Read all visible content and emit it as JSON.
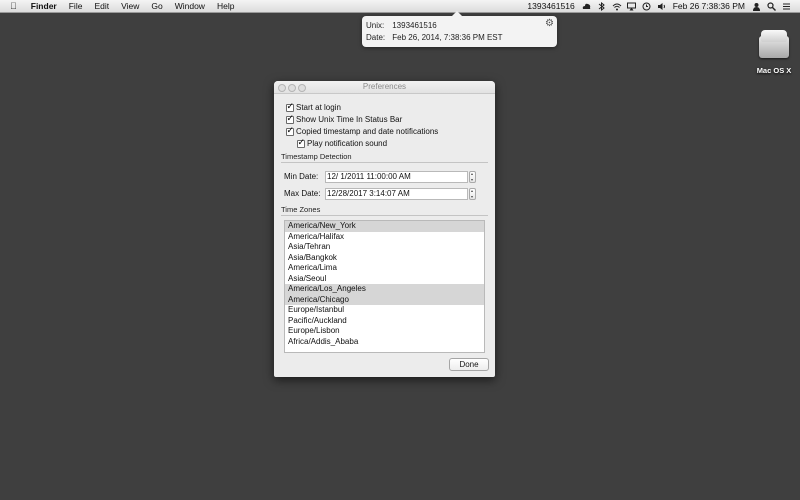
{
  "menubar": {
    "app_name": "Finder",
    "menus": [
      "File",
      "Edit",
      "View",
      "Go",
      "Window",
      "Help"
    ],
    "unix_time": "1393461516",
    "clock": "Feb 26  7:38:36 PM",
    "icons": [
      "bluetooth-icon",
      "wifi-icon",
      "airplay-icon",
      "time-machine-icon",
      "volume-icon",
      "user-icon",
      "search-icon",
      "list-icon"
    ]
  },
  "popover": {
    "unix_label": "Unix:",
    "unix_value": "1393461516",
    "date_label": "Date:",
    "date_value": "Feb 26, 2014, 7:38:36 PM EST"
  },
  "desktop": {
    "disk_label": "Mac OS X"
  },
  "prefs": {
    "title": "Preferences",
    "start_at_login": "Start at login",
    "show_unix_time": "Show Unix Time In Status Bar",
    "copied_notifications": "Copied timestamp and date notifications",
    "play_sound": "Play notification sound",
    "timestamp_detection": "Timestamp Detection",
    "min_date_label": "Min Date:",
    "min_date_value": "12/  1/2011 11:00:00 AM",
    "max_date_label": "Max Date:",
    "max_date_value": "12/28/2017  3:14:07 AM",
    "time_zones_label": "Time Zones",
    "time_zones": [
      "America/New_York",
      "America/Halifax",
      "Asia/Tehran",
      "Asia/Bangkok",
      "America/Lima",
      "Asia/Seoul",
      "America/Los_Angeles",
      "America/Chicago",
      "Europe/Istanbul",
      "Pacific/Auckland",
      "Europe/Lisbon",
      "Africa/Addis_Ababa"
    ],
    "selected_time_zones": [
      "America/New_York",
      "America/Los_Angeles",
      "America/Chicago"
    ],
    "done_label": "Done"
  }
}
